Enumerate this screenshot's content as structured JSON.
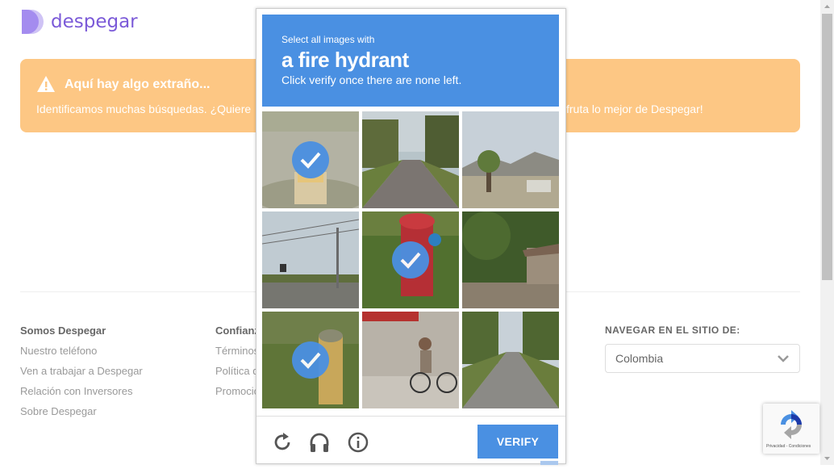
{
  "brand": {
    "name": "despegar",
    "color": "#7b5ad8"
  },
  "alert": {
    "title": "Aquí hay algo extraño...",
    "text_left": "Identificamos muchas búsquedas. ¿Quiere",
    "text_right": "fruta lo mejor de Despegar!",
    "color": "#fdc784"
  },
  "footer": {
    "col1": {
      "heading": "Somos Despegar",
      "links": [
        "Nuestro teléfono",
        "Ven a trabajar a Despegar",
        "Relación con Inversores",
        "Sobre Despegar"
      ]
    },
    "col2": {
      "heading": "Confianz",
      "links": [
        "Términos",
        "Política d",
        "Promocio"
      ]
    },
    "nav": {
      "heading": "NAVEGAR EN EL SITIO DE:",
      "selected": "Colombia"
    }
  },
  "captcha": {
    "line1": "Select all images with",
    "line2": "a fire hydrant",
    "line3": "Click verify once there are none left.",
    "accent": "#4a90e2",
    "verify_label": "VERIFY",
    "tiles": [
      {
        "scene": "hydrant-closeup-yellow",
        "selected": true
      },
      {
        "scene": "residential-street",
        "selected": false
      },
      {
        "scene": "desert-street-palms",
        "selected": false
      },
      {
        "scene": "highway-power-lines",
        "selected": false
      },
      {
        "scene": "red-hydrant-grass",
        "selected": true
      },
      {
        "scene": "tree-fence-house",
        "selected": false
      },
      {
        "scene": "yellow-hydrant-grass",
        "selected": true
      },
      {
        "scene": "kid-on-bicycle",
        "selected": false
      },
      {
        "scene": "street-with-trees",
        "selected": false
      }
    ],
    "icons": [
      "reload-icon",
      "audio-icon",
      "info-icon"
    ]
  },
  "recaptcha_badge": {
    "text": "Privacidad - Condiciones"
  }
}
